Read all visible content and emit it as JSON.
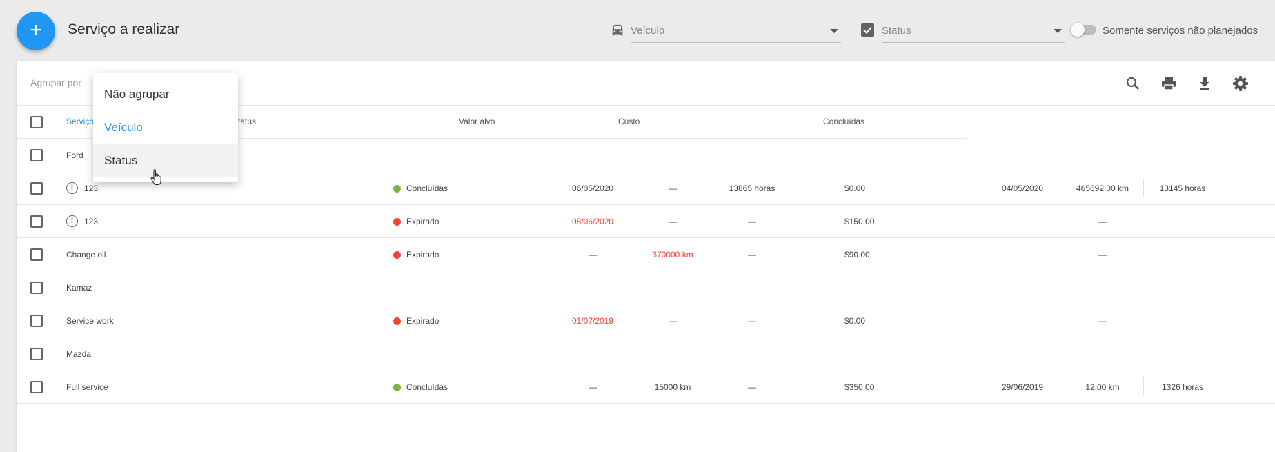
{
  "header": {
    "title": "Serviço a realizar",
    "add_button_label": "+",
    "vehicle_filter_placeholder": "Veículo",
    "status_filter_placeholder": "Status",
    "unplanned_toggle_label": "Somente serviços não planejados",
    "unplanned_toggle_on": false
  },
  "toolbar": {
    "group_by_label": "Agrupar por",
    "icons": [
      "search-icon",
      "print-icon",
      "download-icon",
      "gear-icon"
    ]
  },
  "group_menu": {
    "items": [
      "Não agrupar",
      "Veículo",
      "Status"
    ],
    "selected": "Veículo",
    "hovered": "Status"
  },
  "columns": {
    "service": "Serviço",
    "status": "Status",
    "target": "Valor alvo",
    "cost": "Custo",
    "completed": "Concluídas"
  },
  "colors": {
    "accent": "#2196f3",
    "expired": "#f44336",
    "done": "#7cb342"
  },
  "rows": {
    "g1": {
      "name": "Ford"
    },
    "r1": {
      "service": "123",
      "status": "Concluídas",
      "date": "06/05/2020",
      "km": "—",
      "hours": "13865 horas",
      "cost": "$0.00",
      "done_date": "04/05/2020",
      "done_km": "465692.00 km",
      "done_hours": "13145 horas"
    },
    "r2": {
      "service": "123",
      "status": "Expirado",
      "date": "08/06/2020",
      "km": "—",
      "hours": "—",
      "cost": "$150.00",
      "done": "—"
    },
    "r3": {
      "service": "Change oil",
      "status": "Expirado",
      "date": "—",
      "km": "370000 km",
      "hours": "—",
      "cost": "$90.00",
      "done": "—"
    },
    "g2": {
      "name": "Kamaz"
    },
    "r4": {
      "service": "Service work",
      "status": "Expirado",
      "date": "01/07/2019",
      "km": "—",
      "hours": "—",
      "cost": "$0.00",
      "done": "—"
    },
    "g3": {
      "name": "Mazda"
    },
    "r5": {
      "service": "Full service",
      "status": "Concluídas",
      "date": "—",
      "km": "15000 km",
      "hours": "—",
      "cost": "$350.00",
      "done_date": "29/06/2019",
      "done_km": "12.00 km",
      "done_hours": "1326 horas"
    }
  }
}
